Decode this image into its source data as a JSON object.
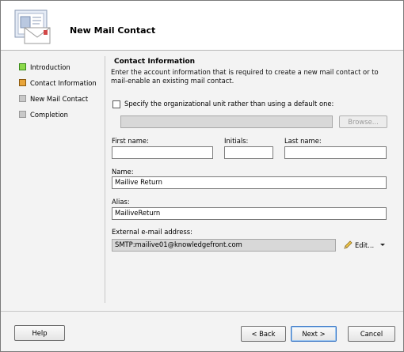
{
  "header": {
    "title": "New Mail Contact"
  },
  "nav": {
    "items": [
      {
        "label": "Introduction",
        "state": "complete",
        "color": "#8cd94a"
      },
      {
        "label": "Contact Information",
        "state": "current",
        "color": "#e8a53a"
      },
      {
        "label": "New Mail Contact",
        "state": "pending",
        "color": "#c8c8c8"
      },
      {
        "label": "Completion",
        "state": "pending",
        "color": "#c8c8c8"
      }
    ]
  },
  "content": {
    "section_title": "Contact Information",
    "description": "Enter the account information that is required to create a new mail contact or to mail-enable an existing mail contact.",
    "ou_checkbox": {
      "label": "Specify the organizational unit rather than using a default one:",
      "checked": false
    },
    "ou_path": {
      "value": ""
    },
    "browse_button": "Browse...",
    "first_name": {
      "label": "First name:",
      "value": ""
    },
    "initials": {
      "label": "Initials:",
      "value": ""
    },
    "last_name": {
      "label": "Last name:",
      "value": ""
    },
    "name": {
      "label": "Name:",
      "value": "Mailive Return"
    },
    "alias": {
      "label": "Alias:",
      "value": "MailiveReturn"
    },
    "external_email": {
      "label": "External e-mail address:",
      "value": "SMTP:mailive01@knowledgefront.com"
    },
    "edit_button": "Edit..."
  },
  "footer": {
    "help": "Help",
    "back": "< Back",
    "next": "Next >",
    "cancel": "Cancel"
  }
}
